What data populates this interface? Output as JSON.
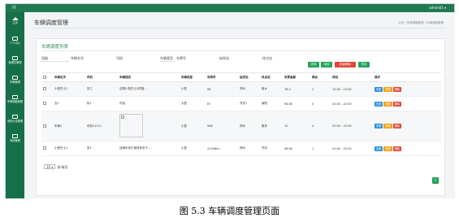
{
  "header": {
    "logo": "H",
    "admin": "admin01 ▾"
  },
  "sidebar": {
    "items": [
      {
        "label": "主页",
        "icon": "home-icon"
      },
      {
        "label": "个人中心",
        "icon": "monitor-icon"
      },
      {
        "label": "管理员管理",
        "icon": "monitor-icon"
      },
      {
        "label": "车辆管理",
        "icon": "monitor-icon"
      },
      {
        "label": "车辆调度管理",
        "icon": "monitor-icon"
      },
      {
        "label": "系统公告管理",
        "icon": "monitor-icon"
      },
      {
        "label": "系统管理",
        "icon": "monitor-icon"
      }
    ]
  },
  "page": {
    "title": "车辆调度管理",
    "breadcrumb": "主页 / 车辆调度管理 / 车辆调度管理"
  },
  "panel": {
    "title": "车辆调度列表",
    "filters": [
      "班级",
      "车辆名字",
      "司机",
      "车辆类型",
      "车牌号",
      "始发站",
      "终点站"
    ],
    "buttons": {
      "search": "查询",
      "add": "添加",
      "batch_delete": "批量删除",
      "export": "导出"
    }
  },
  "table": {
    "headers": [
      "车辆名字",
      "司机",
      "车辆描述",
      "车辆类型",
      "车牌号",
      "始发站",
      "终点站",
      "车票金额",
      "剩余",
      "排班",
      "操作"
    ],
    "rows": [
      [
        "小型巴士2",
        "张三",
        "这是小型巴士2的描...",
        "小型",
        "96",
        "郑州",
        "新乡",
        "78.2",
        "2",
        "12:00 - 14:00"
      ],
      [
        "吉1",
        "阮1",
        "内容",
        "大型",
        "87",
        "开封1",
        "南阳",
        "98.65",
        "0",
        "20:00 - 22:00"
      ],
      [
        "车辆1",
        "司机11111",
        "",
        "小型",
        "588",
        "郑州",
        "焦作",
        "10",
        "4",
        "20:00 - 22:00"
      ],
      [
        "小型巴士1",
        "张1",
        "这辆车用于接待有关于...",
        "小型",
        "41546hu",
        "郑州",
        "开封",
        "98.65",
        "1",
        "20:00 - 22:00"
      ]
    ],
    "ops": {
      "view": "查看",
      "edit": "修改",
      "delete": "删除"
    }
  },
  "pager": {
    "page_size": "10",
    "suffix": "条/每页",
    "current": "1"
  },
  "caption": "图 5.3  车辆调度管理页面",
  "colors": {
    "sidebar": "#15704a",
    "topbar": "#1f7a50",
    "accent": "#22a35a"
  }
}
